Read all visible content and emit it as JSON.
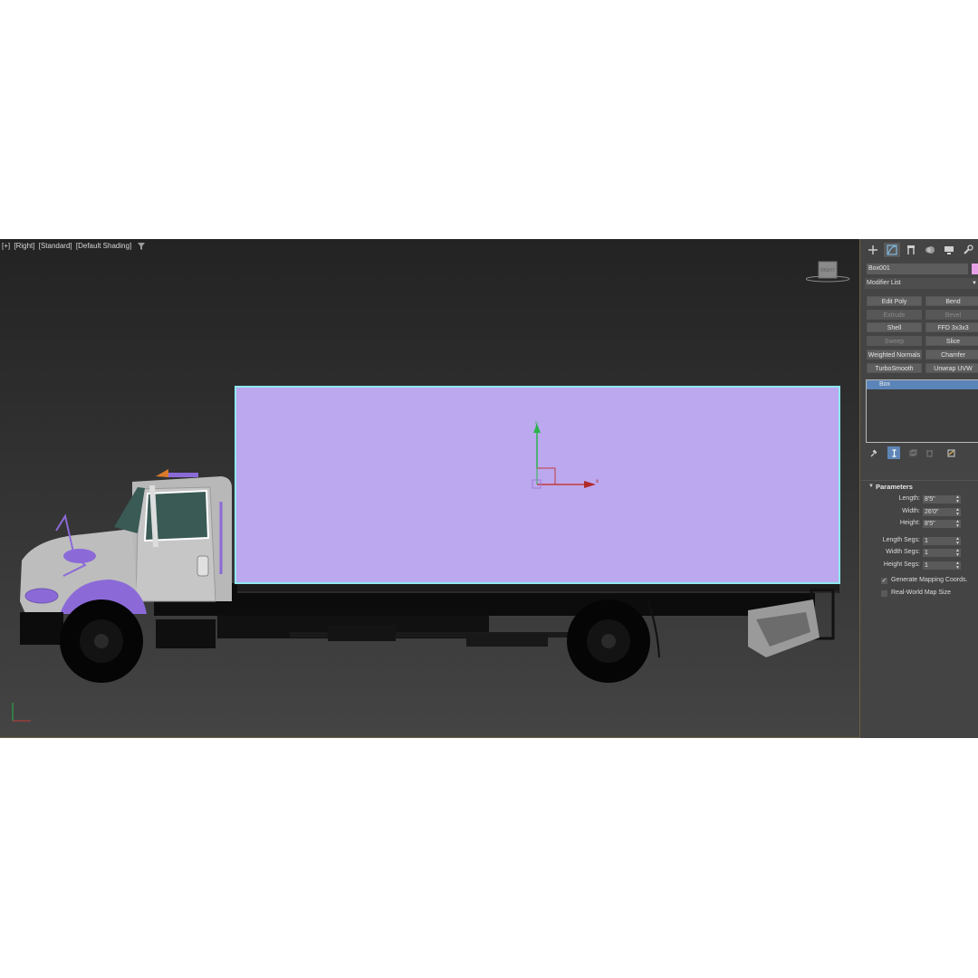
{
  "viewport": {
    "label_parts": [
      "[+]",
      "[Right]",
      "[Standard]",
      "[Default Shading]"
    ],
    "viewcube_label": "RIGHT",
    "gizmo_y_label": "y",
    "gizmo_x_label": "x"
  },
  "command_panel": {
    "tabs": [
      "create-icon",
      "modify-icon",
      "hierarchy-icon",
      "motion-icon",
      "display-icon",
      "utilities-icon"
    ],
    "active_tab": 1,
    "object_name": "Box001",
    "object_color": "#e6a0e6",
    "modifier_list_label": "Modifier List",
    "modifier_buttons": [
      {
        "label": "Edit Poly",
        "enabled": true
      },
      {
        "label": "Bend",
        "enabled": true
      },
      {
        "label": "Extrude",
        "enabled": false
      },
      {
        "label": "Bevel",
        "enabled": false
      },
      {
        "label": "Shell",
        "enabled": true
      },
      {
        "label": "FFD 3x3x3",
        "enabled": true
      },
      {
        "label": "Sweep",
        "enabled": false
      },
      {
        "label": "Slice",
        "enabled": true
      },
      {
        "label": "Weighted Normals",
        "enabled": true
      },
      {
        "label": "Chamfer",
        "enabled": true
      },
      {
        "label": "TurboSmooth",
        "enabled": true
      },
      {
        "label": "Unwrap UVW",
        "enabled": true
      }
    ],
    "stack": [
      "Box"
    ],
    "stack_tools": [
      "pin-stack-icon",
      "show-end-result-icon",
      "make-unique-icon",
      "remove-modifier-icon",
      "configure-modifier-sets-icon"
    ],
    "parameters": {
      "title": "Parameters",
      "fields": [
        {
          "label": "Length:",
          "value": "8'5\""
        },
        {
          "label": "Width:",
          "value": "26'0\""
        },
        {
          "label": "Height:",
          "value": "8'5\""
        },
        {
          "label": "Length Segs:",
          "value": "1"
        },
        {
          "label": "Width Segs:",
          "value": "1"
        },
        {
          "label": "Height Segs:",
          "value": "1"
        }
      ],
      "checkboxes": [
        {
          "label": "Generate Mapping Coords.",
          "checked": true
        },
        {
          "label": "Real-World Map Size",
          "checked": false
        }
      ]
    }
  },
  "colors": {
    "selected_box": "#bca8ee",
    "selection_outline": "#8ee8f0",
    "truck_accent": "#8b6ad8",
    "stack_selected": "#5b84b8"
  }
}
